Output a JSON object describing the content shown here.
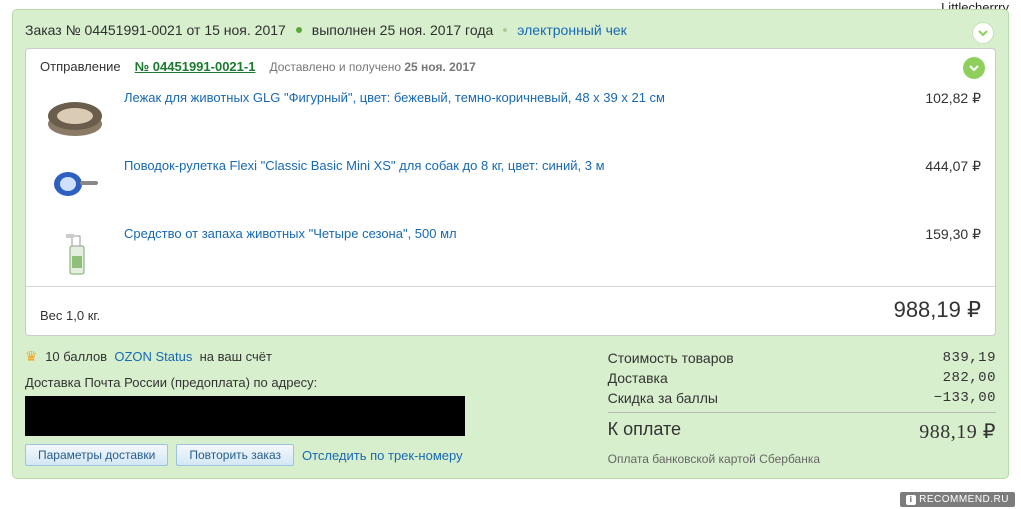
{
  "username": "Littlecherrry",
  "order": {
    "label_prefix": "Заказ №",
    "number": "04451991-0021",
    "date_prefix": "от",
    "date": "15 ноя. 2017",
    "status": "выполнен",
    "status_date": "25 ноя. 2017 года",
    "receipt_link": "электронный чек"
  },
  "shipment": {
    "label": "Отправление",
    "number_prefix": "№",
    "number": "04451991-0021-1",
    "status": "Доставлено и получено",
    "status_date": "25 ноя. 2017",
    "weight_label": "Вес",
    "weight_value": "1,0 кг.",
    "total": "988,19",
    "currency": "₽",
    "items": [
      {
        "name": "Лежак для животных GLG \"Фигурный\", цвет: бежевый, темно-коричневый, 48 х 39 х 21 см",
        "price": "102,82"
      },
      {
        "name": "Поводок-рулетка Flexi \"Classic Basic Mini XS\" для собак до 8 кг, цвет: синий, 3 м",
        "price": "444,07"
      },
      {
        "name": "Средство от запаха животных \"Четыре сезона\", 500 мл",
        "price": "159,30"
      }
    ]
  },
  "bonus": {
    "points": "10 баллов",
    "program": "OZON Status",
    "suffix": "на ваш счёт"
  },
  "delivery": {
    "label": "Доставка Почта России (предоплата) по адресу:"
  },
  "buttons": {
    "params": "Параметры доставки",
    "repeat": "Повторить заказ",
    "track": "Отследить по трек-номеру"
  },
  "summary": {
    "rows": [
      {
        "label": "Стоимость товаров",
        "value": "839,19"
      },
      {
        "label": "Доставка",
        "value": "282,00"
      },
      {
        "label": "Скидка за баллы",
        "value": "−133,00"
      }
    ],
    "total_label": "К оплате",
    "total_value": "988,19",
    "currency": "₽",
    "payment_note": "Оплата банковской картой Сбербанка"
  },
  "watermark": "RECOMMEND.RU"
}
